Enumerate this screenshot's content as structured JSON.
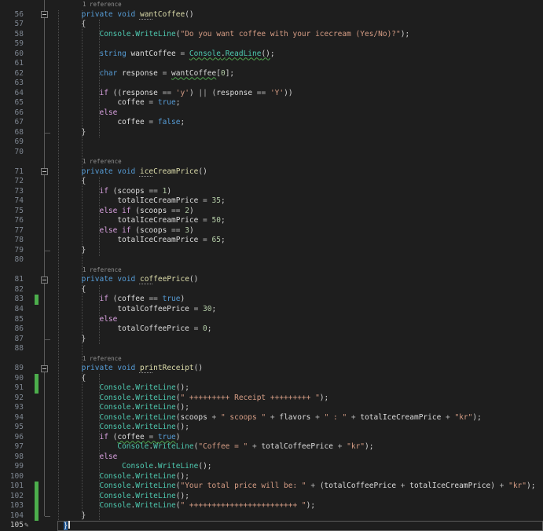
{
  "app": "code-editor",
  "language": "csharp",
  "codelens_label": "1 reference",
  "icons": {
    "pencil": "✎",
    "fold_collapse": "minus-box"
  },
  "colors": {
    "background": "#1e1e1e",
    "line_number": "#7d8590",
    "line_number_active": "#c6c6c6",
    "keyword": "#569cd6",
    "control_keyword": "#d8a0df",
    "class_name": "#4ec9b0",
    "method_call": "#4ec9b0",
    "method_declaration": "#dcdcaa",
    "identifier": "#dcdcdc",
    "string": "#d69d85",
    "number": "#b5cea8",
    "operator": "#b4b4b4",
    "punctuation": "#d4d4d4",
    "codelens": "#8f8f8f",
    "change_bar": "#4cae4c",
    "squiggle": "#4fa64f",
    "brace_highlight": "#235a97",
    "current_line_border": "#5a5a5a",
    "indent_guide": "#4d4d4d",
    "fold_line": "#5a5a5a"
  },
  "cursor": {
    "line": "105",
    "after_text": "}"
  },
  "rows": [
    {
      "cl": 1,
      "ind": 5
    },
    {
      "n": "56",
      "ind": 5,
      "fold": 1,
      "tok": [
        [
          "kw",
          "private "
        ],
        [
          "kw",
          "void "
        ],
        [
          "dcl",
          "wan",
          "dots"
        ],
        [
          "dcl",
          "tCoffee"
        ],
        [
          "pun",
          "()"
        ]
      ]
    },
    {
      "n": "57",
      "ind": 5,
      "tok": [
        [
          "pun",
          "{"
        ]
      ]
    },
    {
      "n": "58",
      "ind": 9,
      "tok": [
        [
          "cls",
          "Console"
        ],
        [
          "pun",
          "."
        ],
        [
          "mth",
          "WriteLine"
        ],
        [
          "pun",
          "("
        ],
        [
          "str",
          "\"Do you want coffee with your icecream (Yes/No)?\""
        ],
        [
          "pun",
          ");"
        ]
      ]
    },
    {
      "n": "59"
    },
    {
      "n": "60",
      "ind": 9,
      "tok": [
        [
          "kw",
          "string "
        ],
        [
          "id",
          "wantCoffee "
        ],
        [
          "op",
          "= "
        ],
        [
          "cls",
          "Console",
          "sq"
        ],
        [
          "pun",
          ".",
          "sq"
        ],
        [
          "mth",
          "ReadLine",
          "sq"
        ],
        [
          "pun",
          "()",
          "sq"
        ],
        [
          "pun",
          ";"
        ]
      ]
    },
    {
      "n": "61"
    },
    {
      "n": "62",
      "ind": 9,
      "tok": [
        [
          "kw",
          "char "
        ],
        [
          "id",
          "response "
        ],
        [
          "op",
          "= "
        ],
        [
          "id",
          "wantCoffee",
          "sq"
        ],
        [
          "pun",
          "["
        ],
        [
          "num",
          "0"
        ],
        [
          "pun",
          "];"
        ]
      ]
    },
    {
      "n": "63"
    },
    {
      "n": "64",
      "ind": 9,
      "tok": [
        [
          "ctl",
          "if "
        ],
        [
          "pun",
          "(("
        ],
        [
          "id",
          "response "
        ],
        [
          "op",
          "== "
        ],
        [
          "str",
          "'y'"
        ],
        [
          "pun",
          ") "
        ],
        [
          "op",
          "|| "
        ],
        [
          "pun",
          "("
        ],
        [
          "id",
          "response "
        ],
        [
          "op",
          "== "
        ],
        [
          "str",
          "'Y'"
        ],
        [
          "pun",
          "))"
        ]
      ]
    },
    {
      "n": "65",
      "ind": 13,
      "tok": [
        [
          "id",
          "coffee "
        ],
        [
          "op",
          "= "
        ],
        [
          "kw",
          "true"
        ],
        [
          "pun",
          ";"
        ]
      ]
    },
    {
      "n": "66",
      "ind": 9,
      "tok": [
        [
          "ctl",
          "else"
        ]
      ]
    },
    {
      "n": "67",
      "ind": 13,
      "tok": [
        [
          "id",
          "coffee "
        ],
        [
          "op",
          "= "
        ],
        [
          "kw",
          "false"
        ],
        [
          "pun",
          ";"
        ]
      ]
    },
    {
      "n": "68",
      "ind": 5,
      "tick": 1,
      "tok": [
        [
          "pun",
          "}"
        ]
      ]
    },
    {
      "n": "69"
    },
    {
      "n": "70"
    },
    {
      "cl": 1,
      "ind": 5
    },
    {
      "n": "71",
      "ind": 5,
      "fold": 1,
      "tok": [
        [
          "kw",
          "private "
        ],
        [
          "kw",
          "void "
        ],
        [
          "dcl",
          "ice",
          "dots"
        ],
        [
          "dcl",
          "CreamPrice"
        ],
        [
          "pun",
          "()"
        ]
      ]
    },
    {
      "n": "72",
      "ind": 5,
      "tok": [
        [
          "pun",
          "{"
        ]
      ]
    },
    {
      "n": "73",
      "ind": 9,
      "tok": [
        [
          "ctl",
          "if "
        ],
        [
          "pun",
          "("
        ],
        [
          "id",
          "scoops "
        ],
        [
          "op",
          "== "
        ],
        [
          "num",
          "1"
        ],
        [
          "pun",
          ")"
        ]
      ]
    },
    {
      "n": "74",
      "ind": 13,
      "tok": [
        [
          "id",
          "totalIceCreamPrice "
        ],
        [
          "op",
          "= "
        ],
        [
          "num",
          "35"
        ],
        [
          "pun",
          ";"
        ]
      ]
    },
    {
      "n": "75",
      "ind": 9,
      "tok": [
        [
          "ctl",
          "else if "
        ],
        [
          "pun",
          "("
        ],
        [
          "id",
          "scoops "
        ],
        [
          "op",
          "== "
        ],
        [
          "num",
          "2"
        ],
        [
          "pun",
          ")"
        ]
      ]
    },
    {
      "n": "76",
      "ind": 13,
      "tok": [
        [
          "id",
          "totalIceCreamPrice "
        ],
        [
          "op",
          "= "
        ],
        [
          "num",
          "50"
        ],
        [
          "pun",
          ";"
        ]
      ]
    },
    {
      "n": "77",
      "ind": 9,
      "tok": [
        [
          "ctl",
          "else if "
        ],
        [
          "pun",
          "("
        ],
        [
          "id",
          "scoops "
        ],
        [
          "op",
          "== "
        ],
        [
          "num",
          "3"
        ],
        [
          "pun",
          ")"
        ]
      ]
    },
    {
      "n": "78",
      "ind": 13,
      "tok": [
        [
          "id",
          "totalIceCreamPrice "
        ],
        [
          "op",
          "= "
        ],
        [
          "num",
          "65"
        ],
        [
          "pun",
          ";"
        ]
      ]
    },
    {
      "n": "79",
      "ind": 5,
      "tick": 1,
      "tok": [
        [
          "pun",
          "}"
        ]
      ]
    },
    {
      "n": "80"
    },
    {
      "cl": 1,
      "ind": 5
    },
    {
      "n": "81",
      "ind": 5,
      "fold": 1,
      "tok": [
        [
          "kw",
          "private "
        ],
        [
          "kw",
          "void "
        ],
        [
          "dcl",
          "cof",
          "dots"
        ],
        [
          "dcl",
          "feePrice"
        ],
        [
          "pun",
          "()"
        ]
      ]
    },
    {
      "n": "82",
      "ind": 5,
      "tok": [
        [
          "pun",
          "{"
        ]
      ]
    },
    {
      "n": "83",
      "ind": 9,
      "chg": 1,
      "tok": [
        [
          "ctl",
          "if "
        ],
        [
          "pun",
          "("
        ],
        [
          "id",
          "coffee "
        ],
        [
          "op",
          "== "
        ],
        [
          "kw",
          "true"
        ],
        [
          "pun",
          ")"
        ]
      ]
    },
    {
      "n": "84",
      "ind": 13,
      "tok": [
        [
          "id",
          "totalCoffeePrice "
        ],
        [
          "op",
          "= "
        ],
        [
          "num",
          "30"
        ],
        [
          "pun",
          ";"
        ]
      ]
    },
    {
      "n": "85",
      "ind": 9,
      "tok": [
        [
          "ctl",
          "else"
        ]
      ]
    },
    {
      "n": "86",
      "ind": 13,
      "tok": [
        [
          "id",
          "totalCoffeePrice "
        ],
        [
          "op",
          "= "
        ],
        [
          "num",
          "0"
        ],
        [
          "pun",
          ";"
        ]
      ]
    },
    {
      "n": "87",
      "ind": 5,
      "tick": 1,
      "tok": [
        [
          "pun",
          "}"
        ]
      ]
    },
    {
      "n": "88"
    },
    {
      "cl": 1,
      "ind": 5
    },
    {
      "n": "89",
      "ind": 5,
      "fold": 1,
      "tok": [
        [
          "kw",
          "private "
        ],
        [
          "kw",
          "void "
        ],
        [
          "dcl",
          "pri",
          "dots"
        ],
        [
          "dcl",
          "ntReceipt"
        ],
        [
          "pun",
          "()"
        ]
      ]
    },
    {
      "n": "90",
      "ind": 5,
      "chg": 1,
      "tok": [
        [
          "pun",
          "{"
        ]
      ]
    },
    {
      "n": "91",
      "ind": 9,
      "chg": 1,
      "tok": [
        [
          "cls",
          "Console"
        ],
        [
          "pun",
          "."
        ],
        [
          "mth",
          "WriteLine"
        ],
        [
          "pun",
          "();"
        ]
      ]
    },
    {
      "n": "92",
      "ind": 9,
      "tok": [
        [
          "cls",
          "Console"
        ],
        [
          "pun",
          "."
        ],
        [
          "mth",
          "WriteLine"
        ],
        [
          "pun",
          "("
        ],
        [
          "str",
          "\" +++++++++ Receipt +++++++++ \""
        ],
        [
          "pun",
          ");"
        ]
      ]
    },
    {
      "n": "93",
      "ind": 9,
      "tok": [
        [
          "cls",
          "Console"
        ],
        [
          "pun",
          "."
        ],
        [
          "mth",
          "WriteLine"
        ],
        [
          "pun",
          "();"
        ]
      ]
    },
    {
      "n": "94",
      "ind": 9,
      "tok": [
        [
          "cls",
          "Console"
        ],
        [
          "pun",
          "."
        ],
        [
          "mth",
          "WriteLine"
        ],
        [
          "pun",
          "("
        ],
        [
          "id",
          "scoops"
        ],
        [
          "op",
          " + "
        ],
        [
          "str",
          "\" scoops \""
        ],
        [
          "op",
          " + "
        ],
        [
          "id",
          "flavors"
        ],
        [
          "op",
          " + "
        ],
        [
          "str",
          "\" : \""
        ],
        [
          "op",
          " + "
        ],
        [
          "id",
          "totalIceCreamPrice"
        ],
        [
          "op",
          " + "
        ],
        [
          "str",
          "\"kr\""
        ],
        [
          "pun",
          ");"
        ]
      ]
    },
    {
      "n": "95",
      "ind": 9,
      "tok": [
        [
          "cls",
          "Console"
        ],
        [
          "pun",
          "."
        ],
        [
          "mth",
          "WriteLine"
        ],
        [
          "pun",
          "();"
        ]
      ]
    },
    {
      "n": "96",
      "ind": 9,
      "tok": [
        [
          "ctl",
          "if "
        ],
        [
          "pun",
          "("
        ],
        [
          "id",
          "coffee",
          "sq"
        ],
        [
          "op",
          " = ",
          "sq"
        ],
        [
          "kw",
          "true",
          "sq"
        ],
        [
          "pun",
          ")"
        ]
      ]
    },
    {
      "n": "97",
      "ind": 13,
      "tok": [
        [
          "cls",
          "Console"
        ],
        [
          "pun",
          "."
        ],
        [
          "mth",
          "WriteLine"
        ],
        [
          "pun",
          "("
        ],
        [
          "str",
          "\"Coffee = \""
        ],
        [
          "op",
          " + "
        ],
        [
          "id",
          "totalCoffeePrice"
        ],
        [
          "op",
          " + "
        ],
        [
          "str",
          "\"kr\""
        ],
        [
          "pun",
          ");"
        ]
      ]
    },
    {
      "n": "98",
      "ind": 9,
      "tok": [
        [
          "ctl",
          "else"
        ]
      ]
    },
    {
      "n": "99",
      "ind": 14,
      "tok": [
        [
          "cls",
          "Console"
        ],
        [
          "pun",
          "."
        ],
        [
          "mth",
          "WriteLine"
        ],
        [
          "pun",
          "();"
        ]
      ]
    },
    {
      "n": "100",
      "ind": 9,
      "tok": [
        [
          "cls",
          "Console"
        ],
        [
          "pun",
          "."
        ],
        [
          "mth",
          "WriteLine"
        ],
        [
          "pun",
          "();"
        ]
      ]
    },
    {
      "n": "101",
      "ind": 9,
      "chg": 1,
      "tok": [
        [
          "cls",
          "Console"
        ],
        [
          "pun",
          "."
        ],
        [
          "mth",
          "WriteLine"
        ],
        [
          "pun",
          "("
        ],
        [
          "str",
          "\"Your total price will be: \""
        ],
        [
          "op",
          " + "
        ],
        [
          "pun",
          "("
        ],
        [
          "id",
          "totalCoffeePrice"
        ],
        [
          "op",
          " + "
        ],
        [
          "id",
          "totalIceCreamPrice"
        ],
        [
          "pun",
          ")"
        ],
        [
          "op",
          " + "
        ],
        [
          "str",
          "\"kr\""
        ],
        [
          "pun",
          ");"
        ]
      ]
    },
    {
      "n": "102",
      "ind": 9,
      "chg": 1,
      "tok": [
        [
          "cls",
          "Console"
        ],
        [
          "pun",
          "."
        ],
        [
          "mth",
          "WriteLine"
        ],
        [
          "pun",
          "();"
        ]
      ]
    },
    {
      "n": "103",
      "ind": 9,
      "chg": 1,
      "tok": [
        [
          "cls",
          "Console"
        ],
        [
          "pun",
          "."
        ],
        [
          "mth",
          "WriteLine"
        ],
        [
          "pun",
          "("
        ],
        [
          "str",
          "\" ++++++++++++++++++++++++ \""
        ],
        [
          "pun",
          ");"
        ]
      ]
    },
    {
      "n": "104",
      "ind": 5,
      "chg": 1,
      "tick": 1,
      "tok": [
        [
          "pun",
          "}"
        ]
      ]
    },
    {
      "n": "105",
      "ind": 1,
      "cur": 1,
      "pencil": 1,
      "caret": 1,
      "tok": [
        [
          "brace",
          "}"
        ]
      ]
    }
  ]
}
